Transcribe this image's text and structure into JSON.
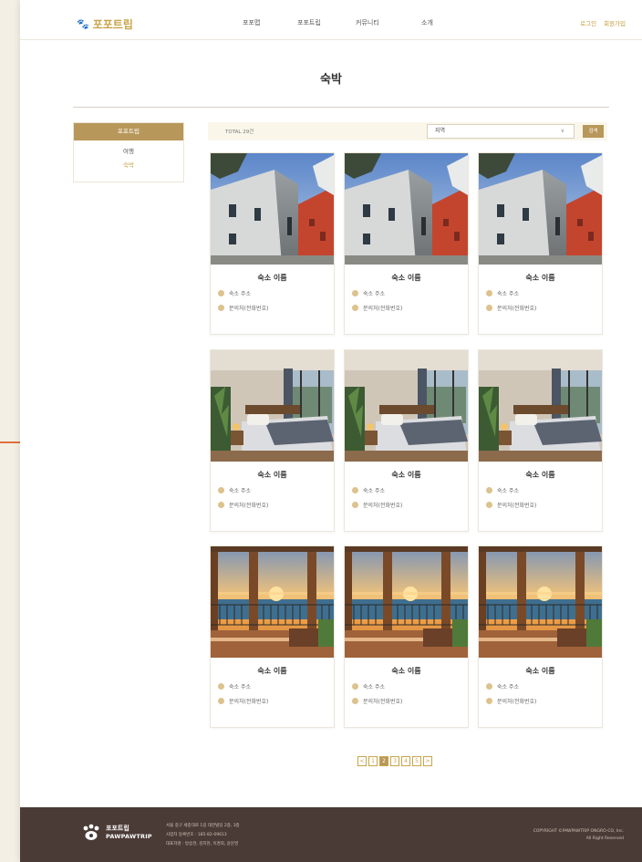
{
  "header": {
    "logo_text": "포포트립",
    "nav": [
      "포포맵",
      "포포트립",
      "커뮤니티",
      "소개"
    ],
    "login": "로그인",
    "signup": "회원가입"
  },
  "page_title": "숙박",
  "sidebar": {
    "heading": "포포트립",
    "items": [
      {
        "label": "여행",
        "active": false
      },
      {
        "label": "숙박",
        "active": true
      }
    ]
  },
  "filter": {
    "total": "TOTAL 29건",
    "region_value": "지역",
    "search_label": "검색"
  },
  "cards": [
    {
      "name": "숙소 이름",
      "address": "숙소 주소",
      "contact": "문의처(전화번호)",
      "photo": "building"
    },
    {
      "name": "숙소 이름",
      "address": "숙소 주소",
      "contact": "문의처(전화번호)",
      "photo": "building"
    },
    {
      "name": "숙소 이름",
      "address": "숙소 주소",
      "contact": "문의처(전화번호)",
      "photo": "building"
    },
    {
      "name": "숙소 이름",
      "address": "숙소 주소",
      "contact": "문의처(전화번호)",
      "photo": "bedroom"
    },
    {
      "name": "숙소 이름",
      "address": "숙소 주소",
      "contact": "문의처(전화번호)",
      "photo": "bedroom"
    },
    {
      "name": "숙소 이름",
      "address": "숙소 주소",
      "contact": "문의처(전화번호)",
      "photo": "bedroom"
    },
    {
      "name": "숙소 이름",
      "address": "숙소 주소",
      "contact": "문의처(전화번호)",
      "photo": "sunset"
    },
    {
      "name": "숙소 이름",
      "address": "숙소 주소",
      "contact": "문의처(전화번호)",
      "photo": "sunset"
    },
    {
      "name": "숙소 이름",
      "address": "숙소 주소",
      "contact": "문의처(전화번호)",
      "photo": "sunset"
    }
  ],
  "pagination": {
    "prev": "<",
    "pages": [
      "1",
      "2",
      "3",
      "4",
      "5"
    ],
    "current": "2",
    "next": ">"
  },
  "footer": {
    "brand": "포포트립",
    "brand_en": "PAWPAWTRIP",
    "info_lines": [
      "서울 중구 세종대로 1길 대한빌딩 2층, 3층",
      "사업자 등록번호 : 185-82-09613",
      "대표자명 : 방승현, 김지현, 이경희, 윤문영"
    ],
    "copyright_1": "COPYRIGHT ©PAWPAWTRIP ONGRO-CO, Inc.",
    "copyright_2": "All Right Reserved"
  },
  "colors": {
    "accent": "#b8975a",
    "logo": "#c9a44a",
    "footer_bg": "#4a3b36",
    "outer_bg": "#f3efe4"
  }
}
